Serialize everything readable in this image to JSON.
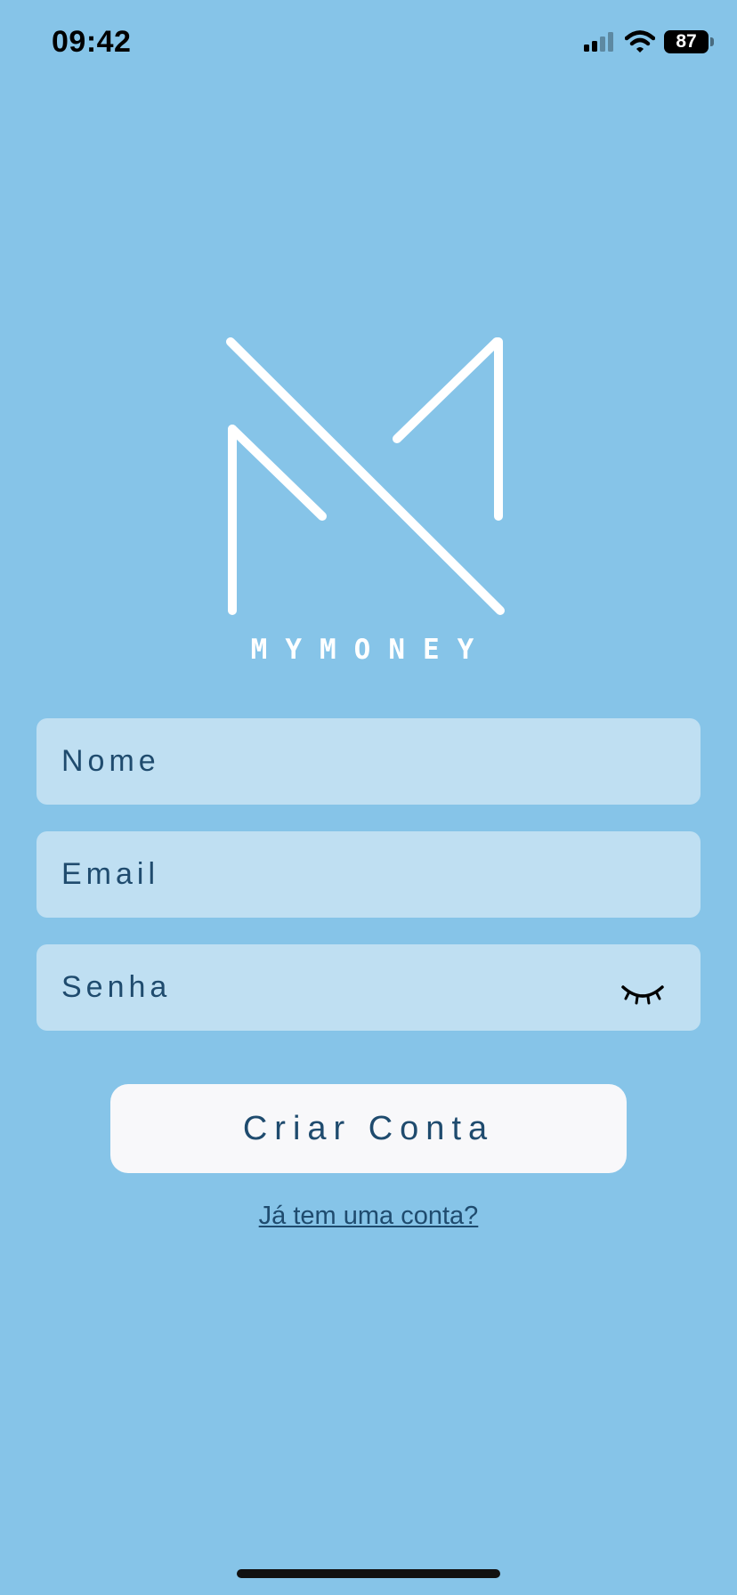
{
  "status_bar": {
    "time": "09:42",
    "battery": "87",
    "signal_icon": "cellular-signal-icon",
    "wifi_icon": "wifi-icon"
  },
  "logo": {
    "wordmark": "MYMONEY",
    "icon": "mymoney-logo"
  },
  "form": {
    "name_placeholder": "Nome",
    "email_placeholder": "Email",
    "password_placeholder": "Senha",
    "password_toggle_icon": "eye-closed-icon",
    "submit_label": "Criar Conta",
    "login_link": "Já tem uma conta?"
  },
  "colors": {
    "background": "#86c4e8",
    "field_background": "#bfdff2",
    "text": "#1f4b6e",
    "button_background": "#f8f8fa"
  }
}
